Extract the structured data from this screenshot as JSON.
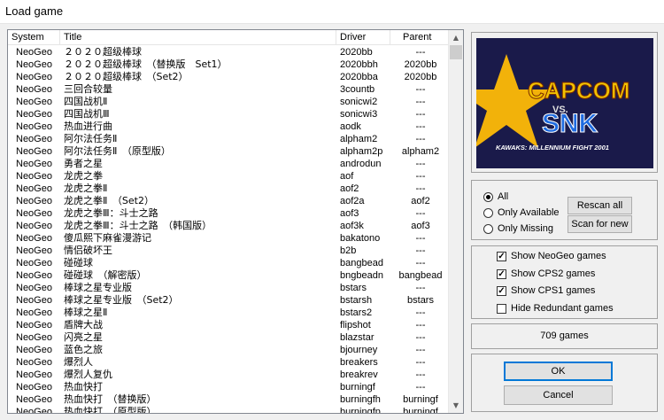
{
  "window": {
    "title": "Load game"
  },
  "columns": {
    "system": "System",
    "title": "Title",
    "driver": "Driver",
    "parent": "Parent"
  },
  "rows": [
    {
      "system": "NeoGeo",
      "title": "２０２０超级棒球",
      "driver": "2020bb",
      "parent": "---"
    },
    {
      "system": "NeoGeo",
      "title": "２０２０超级棒球　（替换版　Set1）",
      "driver": "2020bbh",
      "parent": "2020bb"
    },
    {
      "system": "NeoGeo",
      "title": "２０２０超级棒球　（Set2）",
      "driver": "2020bba",
      "parent": "2020bb"
    },
    {
      "system": "NeoGeo",
      "title": "三回合较量",
      "driver": "3countb",
      "parent": "---"
    },
    {
      "system": "NeoGeo",
      "title": "四国战机Ⅱ",
      "driver": "sonicwi2",
      "parent": "---"
    },
    {
      "system": "NeoGeo",
      "title": "四国战机Ⅲ",
      "driver": "sonicwi3",
      "parent": "---"
    },
    {
      "system": "NeoGeo",
      "title": "热血进行曲",
      "driver": "aodk",
      "parent": "---"
    },
    {
      "system": "NeoGeo",
      "title": "阿尔法任务Ⅱ",
      "driver": "alpham2",
      "parent": "---"
    },
    {
      "system": "NeoGeo",
      "title": "阿尔法任务Ⅱ　（原型版）",
      "driver": "alpham2p",
      "parent": "alpham2"
    },
    {
      "system": "NeoGeo",
      "title": "勇者之星",
      "driver": "androdun",
      "parent": "---"
    },
    {
      "system": "NeoGeo",
      "title": "龙虎之拳",
      "driver": "aof",
      "parent": "---"
    },
    {
      "system": "NeoGeo",
      "title": "龙虎之拳Ⅱ",
      "driver": "aof2",
      "parent": "---"
    },
    {
      "system": "NeoGeo",
      "title": "龙虎之拳Ⅱ　（Set2）",
      "driver": "aof2a",
      "parent": "aof2"
    },
    {
      "system": "NeoGeo",
      "title": "龙虎之拳Ⅲ：斗士之路",
      "driver": "aof3",
      "parent": "---"
    },
    {
      "system": "NeoGeo",
      "title": "龙虎之拳Ⅲ：斗士之路　（韩国版）",
      "driver": "aof3k",
      "parent": "aof3"
    },
    {
      "system": "NeoGeo",
      "title": "傻瓜熙下麻雀漫游记",
      "driver": "bakatono",
      "parent": "---"
    },
    {
      "system": "NeoGeo",
      "title": "情侣破坏王",
      "driver": "b2b",
      "parent": "---"
    },
    {
      "system": "NeoGeo",
      "title": "碰碰球",
      "driver": "bangbead",
      "parent": "---"
    },
    {
      "system": "NeoGeo",
      "title": "碰碰球　（解密版）",
      "driver": "bngbeadn",
      "parent": "bangbead"
    },
    {
      "system": "NeoGeo",
      "title": "棒球之星专业版",
      "driver": "bstars",
      "parent": "---"
    },
    {
      "system": "NeoGeo",
      "title": "棒球之星专业版　（Set2）",
      "driver": "bstarsh",
      "parent": "bstars"
    },
    {
      "system": "NeoGeo",
      "title": "棒球之星Ⅱ",
      "driver": "bstars2",
      "parent": "---"
    },
    {
      "system": "NeoGeo",
      "title": "盾牌大战",
      "driver": "flipshot",
      "parent": "---"
    },
    {
      "system": "NeoGeo",
      "title": "闪亮之星",
      "driver": "blazstar",
      "parent": "---"
    },
    {
      "system": "NeoGeo",
      "title": "蓝色之旅",
      "driver": "bjourney",
      "parent": "---"
    },
    {
      "system": "NeoGeo",
      "title": "爆烈人",
      "driver": "breakers",
      "parent": "---"
    },
    {
      "system": "NeoGeo",
      "title": "爆烈人复仇",
      "driver": "breakrev",
      "parent": "---"
    },
    {
      "system": "NeoGeo",
      "title": "热血快打",
      "driver": "burningf",
      "parent": "---"
    },
    {
      "system": "NeoGeo",
      "title": "热血快打　（替换版）",
      "driver": "burningfh",
      "parent": "burningf"
    },
    {
      "system": "NeoGeo",
      "title": "热血快打　（原型版）",
      "driver": "burningfp",
      "parent": "burningf"
    }
  ],
  "preview": {
    "logo_line1": "CAPCOM",
    "logo_vs": "VS.",
    "logo_line2": "SNK",
    "logo_sub": "KAWAKS: MILLENNIUM FIGHT 2001",
    "colors": {
      "bg": "#1a1a4a",
      "star": "#f2b20a",
      "capcom": "#f2c200",
      "snk": "#1e6be0"
    }
  },
  "filter": {
    "all": "All",
    "available": "Only Available",
    "missing": "Only Missing",
    "selected": "all",
    "rescan_label": "Rescan all",
    "scan_new_label": "Scan for new"
  },
  "options": [
    {
      "label": "Show NeoGeo games",
      "checked": true
    },
    {
      "label": "Show CPS2 games",
      "checked": true
    },
    {
      "label": "Show CPS1 games",
      "checked": true
    },
    {
      "label": "Hide Redundant games",
      "checked": false
    }
  ],
  "status": {
    "count": "709 games"
  },
  "actions": {
    "ok": "OK",
    "cancel": "Cancel"
  }
}
